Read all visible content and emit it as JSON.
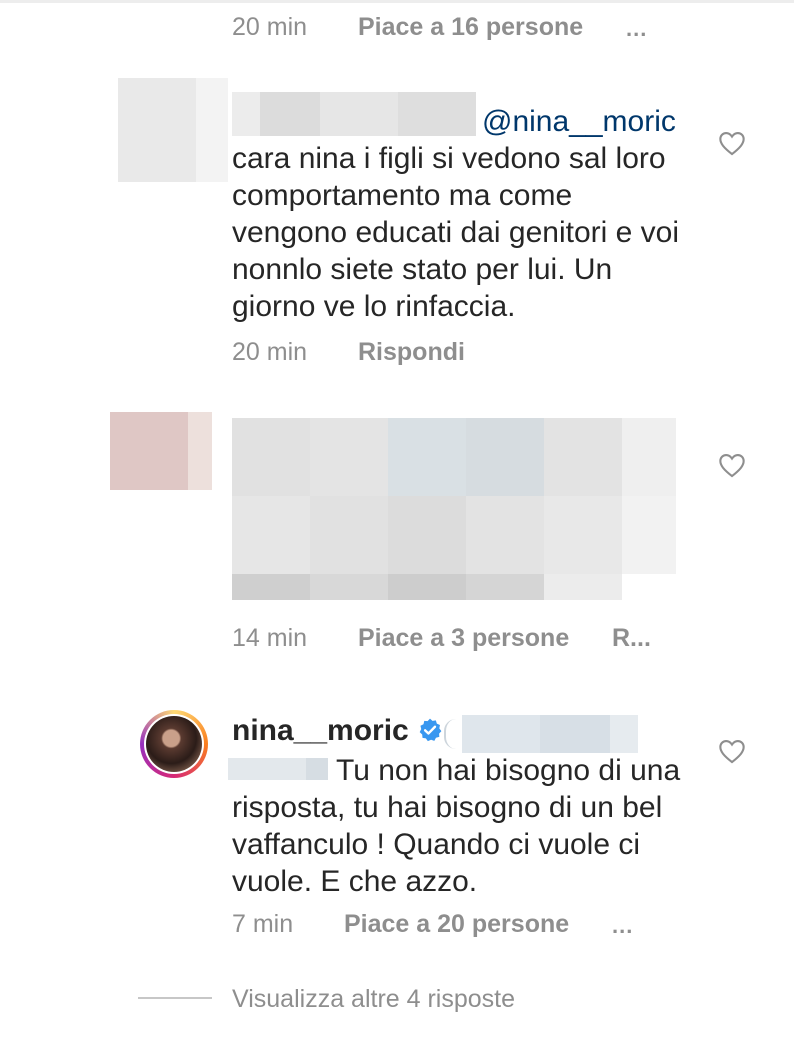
{
  "top_comment": {
    "time": "20 min",
    "likes": "Piace a 16 persone",
    "more": "..."
  },
  "reply_1": {
    "mention": "@nina__moric",
    "text": "cara nina i figli si vedono sal loro comportamento ma come vengono educati dai genitori e voi nonnlo siete stato per lui. Un giorno ve lo rinfaccia.",
    "time": "20 min",
    "reply_label": "Rispondi"
  },
  "reply_2": {
    "time": "14 min",
    "likes": "Piace a 3 persone",
    "reply_label": "R..."
  },
  "reply_3": {
    "username": "nina__moric",
    "text": "Tu non hai bisogno di una risposta, tu hai bisogno di un bel vaffanculo ! Quando ci vuole ci vuole. E che azzo.",
    "time": "7 min",
    "likes": "Piace a 20 persone",
    "more": "..."
  },
  "view_more": {
    "label": "Visualizza altre 4 risposte"
  },
  "colors": {
    "text": "#262626",
    "secondary": "#8e8e8e",
    "mention": "#00376b",
    "verified": "#3897f0"
  },
  "icons": {
    "like": "heart-outline-icon",
    "verified": "verified-badge-icon"
  }
}
